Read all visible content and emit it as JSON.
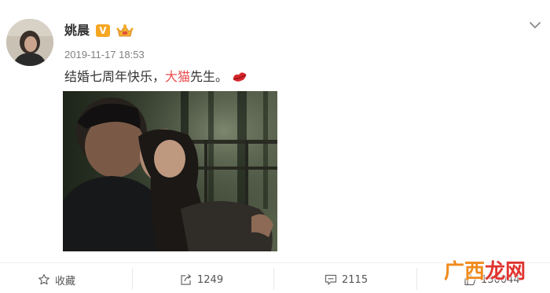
{
  "post": {
    "author": "姚晨",
    "verified_badge": "V",
    "timestamp": "2019-11-17 18:53",
    "text_before": "结婚七周年快乐，",
    "mention": "大猫",
    "text_after": "先生。",
    "emoji": "kiss-lips-icon"
  },
  "actions": {
    "favorite_label": "收藏",
    "repost_count": "1249",
    "comment_count": "2115",
    "like_count": "130044"
  },
  "watermark": {
    "part1": "广西",
    "part2": "龙网"
  },
  "colors": {
    "mention": "#eb4d4d",
    "badge": "#f6a623",
    "timestamp": "#808080",
    "watermark_orange": "#f08a1c",
    "watermark_red": "#e0342f"
  }
}
